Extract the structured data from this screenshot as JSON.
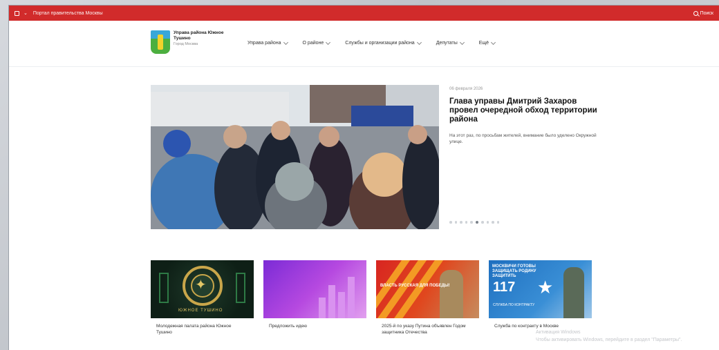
{
  "topbar": {
    "portal_label": "Портал правительства Москвы",
    "search_label": "Поиск"
  },
  "logo": {
    "line1": "Управа района Южное",
    "line2": "Тушино",
    "line3": "Город Москва"
  },
  "nav": {
    "items": [
      {
        "label": "Управа района"
      },
      {
        "label": "О районе"
      },
      {
        "label": "Службы и организации района"
      },
      {
        "label": "Депутаты"
      },
      {
        "label": "Ещё"
      }
    ]
  },
  "hero": {
    "date": "06 февраля 2026",
    "title": "Глава управы Дмитрий Захаров провел очередной обход территории района",
    "description": "На этот раз, по просьбам жителей, внимание было уделено Окружной улице.",
    "slides_total": 10,
    "active_slide": 5
  },
  "cards": [
    {
      "caption": "Молодежная палата района Южное Тушино",
      "thumb_text": "ЮЖНОЕ ТУШИНО"
    },
    {
      "caption": "Предложить идею"
    },
    {
      "caption": "2025-й по указу Путина объявлен Годом защитника Отечества",
      "thumb_text": "ВЛАСТЬ РУССКАЯ ДЛЯ ПОБЕДЫ!"
    },
    {
      "caption": "Служба по контракту в Москве",
      "thumb_head": "МОСКВИЧИ ГОТОВЫ ЗАЩИЩАТЬ РОДИНУ ЗАЩИТИТЬ",
      "thumb_num": "117",
      "thumb_foot": "СЛУЖБА ПО КОНТРАКТУ"
    }
  ],
  "watermark": {
    "line1": "Активация Windows",
    "line2": "Чтобы активировать Windows, перейдите в раздел \"Параметры\"."
  },
  "colors": {
    "topbar": "#d12b2b",
    "text_primary": "#111111"
  }
}
